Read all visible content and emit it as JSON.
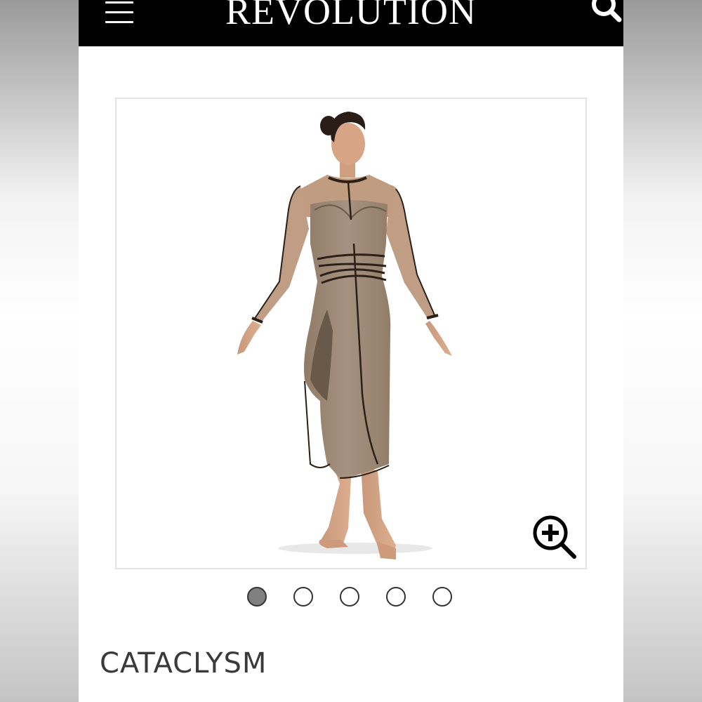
{
  "header": {
    "brand": "REVOLUTION",
    "menu_icon": "hamburger-menu-icon",
    "search_icon": "search-icon",
    "background_color": "#000000"
  },
  "gallery": {
    "zoom_icon": "zoom-in-icon",
    "image_count": 5,
    "active_index": 0
  },
  "product": {
    "title": "CATACLYSM"
  },
  "colors": {
    "dress_taupe": "#a08c77",
    "trim": "#2b1f17",
    "dot_active": "#808080"
  }
}
